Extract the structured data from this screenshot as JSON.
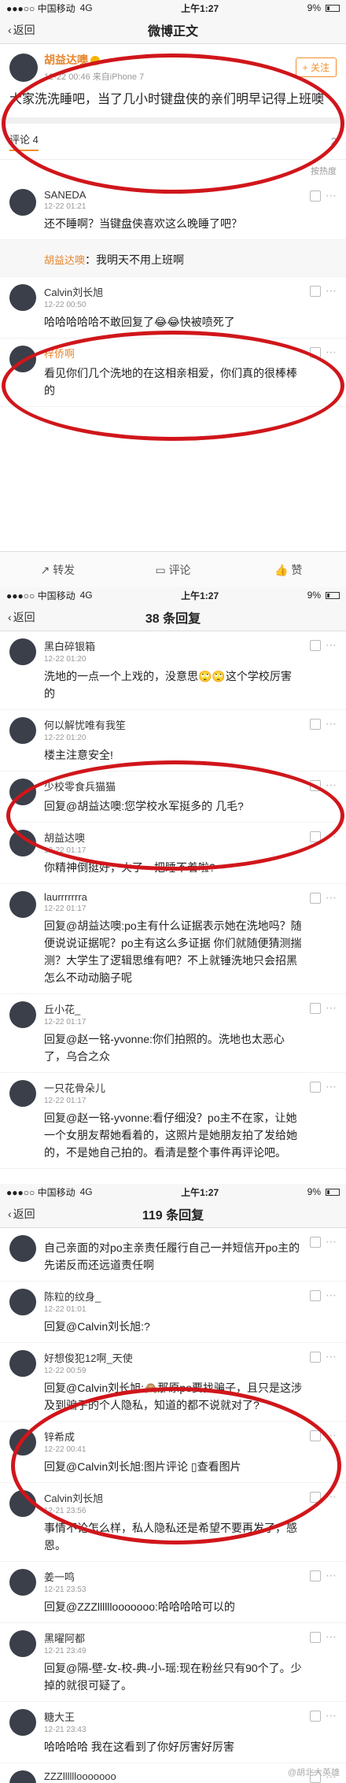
{
  "s1": {
    "status": {
      "carrier": "●●●○○ 中国移动",
      "network": "4G",
      "time": "上午1:27",
      "battery": "9%"
    },
    "nav": {
      "back": "返回",
      "title": "微博正文"
    },
    "post": {
      "author": "胡益达噢",
      "time": "12-22 00:46",
      "source": "来自iPhone 7",
      "follow": "+ 关注",
      "text": "大家洗洗睡吧，当了几小时键盘侠的亲们明早记得上班噢"
    },
    "tabs": {
      "comments": "评论 4",
      "like_count": "2"
    },
    "sort": "按热度",
    "comments": [
      {
        "name": "SANEDA",
        "time": "12-22 01:21",
        "text": "还不睡啊？当键盘侠喜欢这么晚睡了吧？"
      },
      {
        "name": "胡益达噢",
        "time": "",
        "text": "我明天不用上班啊"
      },
      {
        "name": "Calvin刘长旭",
        "time": "12-22 00:50",
        "text": "哈哈哈哈哈不敢回复了😂😂快被喷死了"
      },
      {
        "name": "梓侨啊",
        "time": "",
        "text": "看见你们几个洗地的在这相亲相爱，你们真的很棒棒的"
      }
    ],
    "footer": {
      "repost": "转发",
      "comment": "评论",
      "like": "赞"
    }
  },
  "s2": {
    "status": {
      "carrier": "●●●○○ 中国移动",
      "network": "4G",
      "time": "上午1:27",
      "battery": "9%"
    },
    "nav": {
      "back": "返回",
      "title": "38 条回复"
    },
    "comments": [
      {
        "name": "黑白碎银箱",
        "time": "12-22 01:20",
        "text": "洗地的一点一个上戏的，没意思🙄🙄这个学校厉害的"
      },
      {
        "name": "何以解忧唯有我笙",
        "time": "12-22 01:20",
        "text": "楼主注意安全!"
      },
      {
        "name": "少校零食兵猫猫",
        "time": "",
        "text": "回复@胡益达噢:您学校水军挺多的 几毛?"
      },
      {
        "name": "胡益达噢",
        "time": "12-22 01:17",
        "text": "你精神倒挺好，火了一把睡不着啦?"
      },
      {
        "name": "laurrrrrrra",
        "time": "12-22 01:17",
        "text": "回复@胡益达噢:po主有什么证据表示她在洗地吗？随便说说证据呢？po主有这么多证据 你们就随便猜测揣测？大学生了逻辑思维有吧？不上就锤洗地只会招黑 怎么不动动脑子呢"
      },
      {
        "name": "丘小花_",
        "time": "12-22 01:17",
        "text": "回复@赵一铭-yvonne:你们拍照的。洗地也太恶心了，乌合之众"
      },
      {
        "name": "一只花骨朵儿",
        "time": "12-22 01:17",
        "text": "回复@赵一铭-yvonne:看仔细没？po主不在家，让她一个女朋友帮她看着的，这照片是她朋友拍了发给她的，不是她自己拍的。看清是整个事件再评论吧。"
      }
    ]
  },
  "s3": {
    "status": {
      "carrier": "●●●○○ 中国移动",
      "network": "4G",
      "time": "上午1:27",
      "battery": "9%"
    },
    "nav": {
      "back": "返回",
      "title": "119 条回复"
    },
    "comments": [
      {
        "name": "",
        "time": "",
        "text": "自己亲面的对po主亲责任履行自己一并短信开po主的先诺反而还远道责任啊"
      },
      {
        "name": "陈粒的纹身_",
        "time": "12-22 01:01",
        "text": "回复@Calvin刘长旭:?"
      },
      {
        "name": "好想俊犯12啊_天使",
        "time": "12-22 00:59",
        "text": "回复@Calvin刘长旭:🙈那原po要找骗子，且只是这涉及到骗子的个人隐私，知道的都不说就对了?"
      },
      {
        "name": "锌希成",
        "time": "12-22 00:41",
        "text": "回复@Calvin刘长旭:图片评论 ▯查看图片"
      },
      {
        "name": "Calvin刘长旭",
        "time": "12-21 23:56",
        "text": "事情不论怎么样，私人隐私还是希望不要再发了，感恩。"
      },
      {
        "name": "姜一鸣",
        "time": "12-21 23:53",
        "text": "回复@ZZZllllllooooooo:哈哈哈哈可以的"
      },
      {
        "name": "黑曜阿都",
        "time": "12-21 23:49",
        "text": "回复@隔-壁-女-校-典-小-瑶:现在粉丝只有90个了。少掉的就很可疑了。"
      },
      {
        "name": "糖大王",
        "time": "12-21 23:43",
        "text": "哈哈哈哈 我在这看到了你好厉害好厉害"
      },
      {
        "name": "ZZZllllllooooooo",
        "time": "12-21 23:42",
        "text": "回复@么么么么六就:这都能挂啊"
      }
    ],
    "watermark": "@胡北大英雄"
  },
  "colors": {
    "circle": "#d0161b",
    "accent": "#f28e2b",
    "link": "#4a7fb5"
  }
}
